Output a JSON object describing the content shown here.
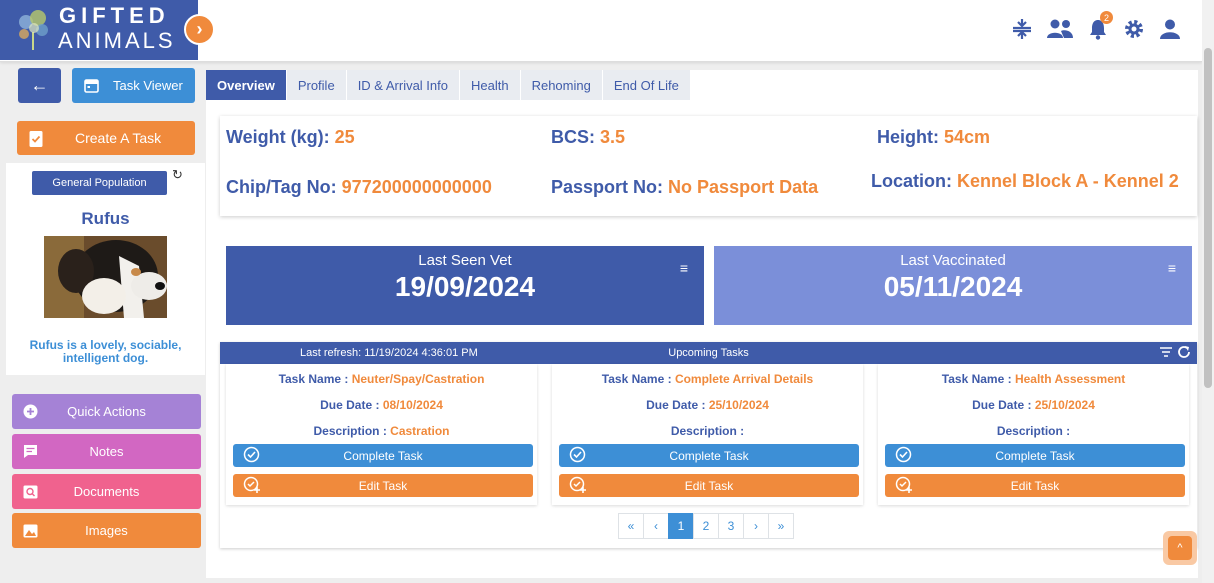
{
  "brand": {
    "line1": "GIFTED",
    "line2": "ANIMALS"
  },
  "header": {
    "notification_count": "2",
    "icons": [
      "compress-icon",
      "people-icon",
      "bell-icon",
      "gear-icon",
      "user-icon"
    ]
  },
  "sidebar": {
    "task_viewer_label": "Task Viewer",
    "create_task_label": "Create A Task",
    "population_badge": "General Population",
    "pet_name": "Rufus",
    "pet_description": "Rufus is a lovely, sociable, intelligent dog.",
    "nav": [
      {
        "label": "Quick Actions",
        "icon": "plus-circle-icon",
        "color": "#a582d6"
      },
      {
        "label": "Notes",
        "icon": "note-icon",
        "color": "#d267c2"
      },
      {
        "label": "Documents",
        "icon": "document-icon",
        "color": "#f0628e"
      },
      {
        "label": "Images",
        "icon": "image-icon",
        "color": "#f08a3c"
      }
    ]
  },
  "tabs": [
    "Overview",
    "Profile",
    "ID & Arrival Info",
    "Health",
    "Rehoming",
    "End Of Life"
  ],
  "overview": {
    "weight": {
      "label": "Weight (kg):",
      "value": "25"
    },
    "bcs": {
      "label": "BCS:",
      "value": "3.5"
    },
    "height": {
      "label": "Height:",
      "value": "54cm"
    },
    "chip": {
      "label": "Chip/Tag No:",
      "value": "977200000000000"
    },
    "passport": {
      "label": "Passport No:",
      "value": "No Passport Data"
    },
    "location": {
      "label": "Location:",
      "value": "Kennel Block A - Kennel 2"
    }
  },
  "stats": {
    "vet": {
      "title": "Last Seen Vet",
      "date": "19/09/2024",
      "color": "#3f5ba9"
    },
    "vaccinated": {
      "title": "Last Vaccinated",
      "date": "05/11/2024",
      "color": "#7b8fd9"
    }
  },
  "tasks": {
    "last_refresh": "Last refresh: 11/19/2024 4:36:01 PM",
    "title": "Upcoming Tasks",
    "name_label": "Task Name :",
    "due_label": "Due Date :",
    "desc_label": "Description :",
    "complete_label": "Complete Task",
    "edit_label": "Edit Task",
    "items": [
      {
        "name": "Neuter/Spay/Castration",
        "due": "08/10/2024",
        "description": "Castration"
      },
      {
        "name": "Complete Arrival Details",
        "due": "25/10/2024",
        "description": ""
      },
      {
        "name": "Health Assessment",
        "due": "25/10/2024",
        "description": ""
      }
    ],
    "pagination": [
      "«",
      "‹",
      "1",
      "2",
      "3",
      "›",
      "»"
    ],
    "current_page": "1"
  },
  "colors": {
    "primary": "#3f5ba9",
    "accent": "#f08a3c",
    "blue": "#3d8fd6"
  }
}
